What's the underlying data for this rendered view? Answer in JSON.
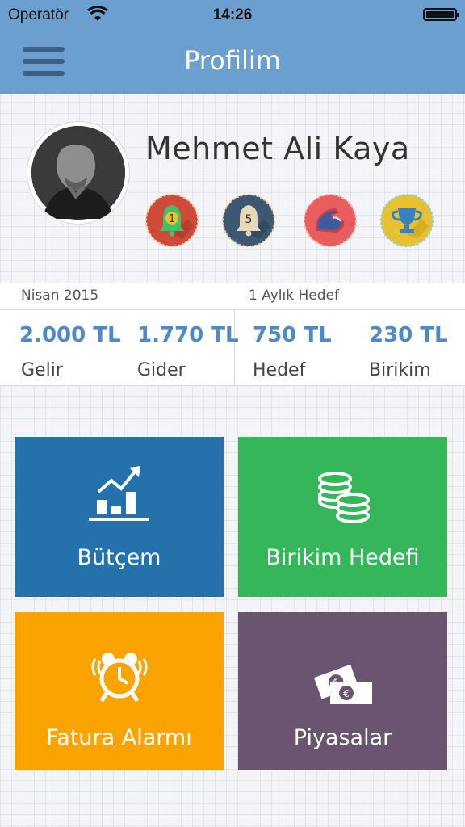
{
  "status_bar": {
    "carrier": "Operatör",
    "time": "14:26"
  },
  "header": {
    "title": "Profilim"
  },
  "profile": {
    "name": "Mehmet Ali Kaya",
    "badges": [
      {
        "icon": "bell-icon",
        "number": "1",
        "color": "#d04a3a"
      },
      {
        "icon": "bell-icon",
        "number": "5",
        "color": "#3e5873"
      },
      {
        "icon": "flexed-arm-icon",
        "number": "",
        "color": "#e85d5d"
      },
      {
        "icon": "trophy-icon",
        "number": "",
        "color": "#e7c12e"
      }
    ]
  },
  "summary": {
    "period": "Nisan 2015",
    "goal_period": "1 Aylık Hedef",
    "items": [
      {
        "value": "2.000 TL",
        "label": "Gelir"
      },
      {
        "value": "1.770 TL",
        "label": "Gider"
      },
      {
        "value": "750 TL",
        "label": "Hedef"
      },
      {
        "value": "230 TL",
        "label": "Birikim"
      }
    ]
  },
  "tiles": [
    {
      "label": "Bütçem",
      "icon": "chart-up-icon",
      "color": "#2471ab"
    },
    {
      "label": "Birikim Hedefi",
      "icon": "coins-icon",
      "color": "#36b65b"
    },
    {
      "label": "Fatura Alarmı",
      "icon": "alarm-clock-icon",
      "color": "#fba300"
    },
    {
      "label": "Piyasalar",
      "icon": "money-icon",
      "color": "#6a5570"
    }
  ]
}
